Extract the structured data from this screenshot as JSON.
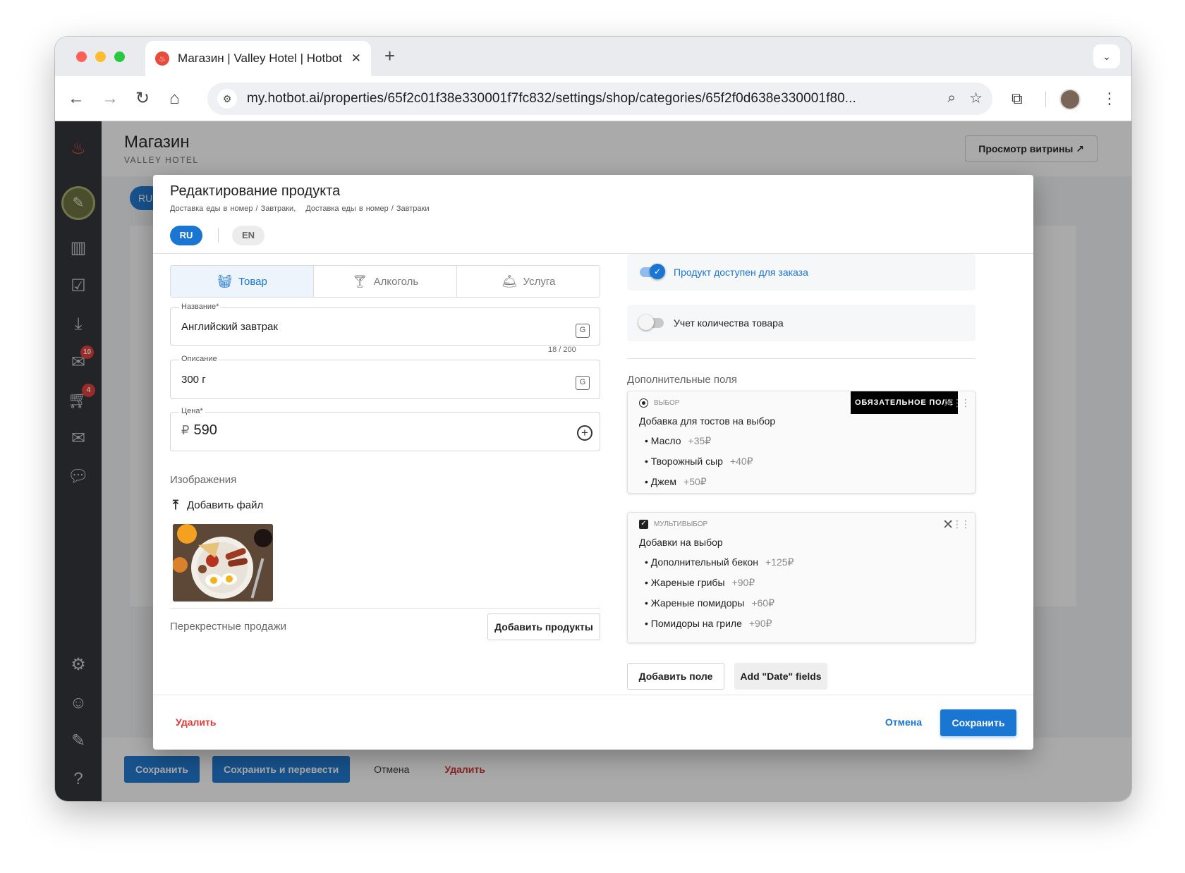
{
  "browser": {
    "tab_title": "Магазин | Valley Hotel | Hotbot",
    "url": "my.hotbot.ai/properties/65f2c01f38e330001f7fc832/settings/shop/categories/65f2f0d638e330001f80..."
  },
  "app": {
    "title": "Магазин",
    "subtitle": "VALLEY HOTEL",
    "view_button": "Просмотр витрины ↗",
    "lang_peek": "RU",
    "bottom_bar": {
      "save": "Сохранить",
      "save_translate": "Сохранить и перевести",
      "cancel": "Отмена",
      "delete": "Удалить"
    },
    "badges": {
      "inbox": "10",
      "cart": "4"
    }
  },
  "modal": {
    "title": "Редактирование продукта",
    "breadcrumbs": [
      "Доставка еды в номер / Завтраки,",
      "Доставка еды в номер / Завтраки"
    ],
    "languages": [
      "RU",
      "EN"
    ],
    "type_tabs": [
      "Товар",
      "Алкоголь",
      "Услуга"
    ],
    "name_field": {
      "label": "Название*",
      "value": "Английский завтрак"
    },
    "char_count": "18 / 200",
    "description_field": {
      "label": "Описание",
      "value": "300 г"
    },
    "price_field": {
      "label": "Цена*",
      "currency": "₽",
      "value": "590"
    },
    "images_label": "Изображения",
    "add_file": "Добавить файл",
    "cross_sales_label": "Перекрестные продажи",
    "add_products": "Добавить продукты",
    "available_toggle": "Продукт доступен для заказа",
    "stock_toggle": "Учет количества товара",
    "extra_fields_label": "Дополнительные поля",
    "options": [
      {
        "kind": "ВЫБОР",
        "name": "Добавка для тостов на выбор",
        "required_badge": "ОБЯЗАТЕЛЬНОЕ ПОЛЕ",
        "items": [
          {
            "name": "Масло",
            "price": "+35₽"
          },
          {
            "name": "Творожный сыр",
            "price": "+40₽"
          },
          {
            "name": "Джем",
            "price": "+50₽"
          }
        ]
      },
      {
        "kind": "МУЛЬТИВЫБОР",
        "name": "Добавки на выбор",
        "items": [
          {
            "name": "Дополнительный бекон",
            "price": "+125₽"
          },
          {
            "name": "Жареные грибы",
            "price": "+90₽"
          },
          {
            "name": "Жареные помидоры",
            "price": "+60₽"
          },
          {
            "name": "Помидоры на гриле",
            "price": "+90₽"
          }
        ]
      }
    ],
    "add_field": "Добавить поле",
    "add_date_fields": "Add \"Date\" fields",
    "footer": {
      "delete": "Удалить",
      "cancel": "Отмена",
      "save": "Сохранить"
    }
  },
  "colors": {
    "accent": "#1976d2",
    "danger": "#e53935",
    "sidebar": "#2b2e33"
  }
}
